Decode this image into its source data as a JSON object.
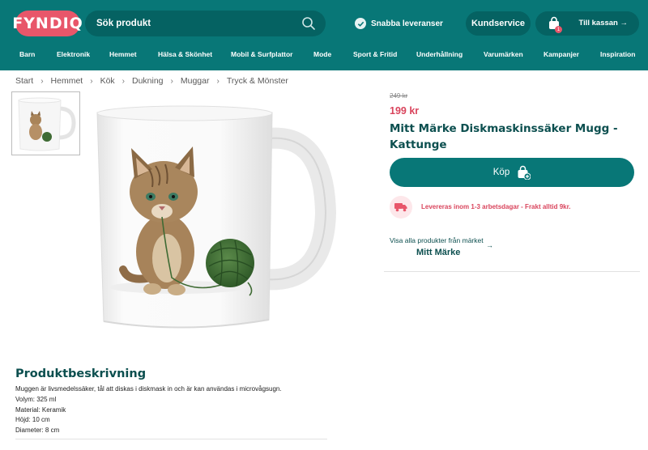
{
  "header": {
    "logo": "FYNDIQ",
    "search_placeholder": "Sök produkt",
    "fast_delivery": "Snabba leveranser",
    "customer_service": "Kundservice",
    "cart_count": "1",
    "checkout": "Till kassan →"
  },
  "nav": [
    {
      "label": "Barn"
    },
    {
      "label": "Elektronik"
    },
    {
      "label": "Hemmet"
    },
    {
      "label": "Hälsa & Skönhet"
    },
    {
      "label": "Mobil & Surfplattor"
    },
    {
      "label": "Mode"
    },
    {
      "label": "Sport & Fritid"
    },
    {
      "label": "Underhållning"
    },
    {
      "label": "Varumärken"
    },
    {
      "label": "Kampanjer"
    },
    {
      "label": "Inspiration"
    }
  ],
  "breadcrumb": [
    "Start",
    "Hemmet",
    "Kök",
    "Dukning",
    "Muggar",
    "Tryck & Mönster"
  ],
  "product": {
    "old_price": "249 kr",
    "price": "199 kr",
    "title": "Mitt Märke Diskmaskinssäker Mugg - Kattunge",
    "buy_label": "Köp",
    "delivery": "Levereras inom 1-3 arbetsdagar - Frakt alltid 9kr.",
    "brand_link": "Visa alla produkter från märket",
    "brand_name": "Mitt Märke"
  },
  "description": {
    "title": "Produktbeskrivning",
    "lines": [
      "Muggen är livsmedelssäker, tål att diskas i diskmask in och är kan användas i microvågsugn.",
      "Volym: 325 ml",
      "Material: Keramik",
      "Höjd: 10 cm",
      "Diameter: 8 cm"
    ]
  },
  "colors": {
    "teal": "#087777",
    "teal_dark": "#056262",
    "pink": "#e8566a",
    "title_teal": "#0c4f4f"
  }
}
